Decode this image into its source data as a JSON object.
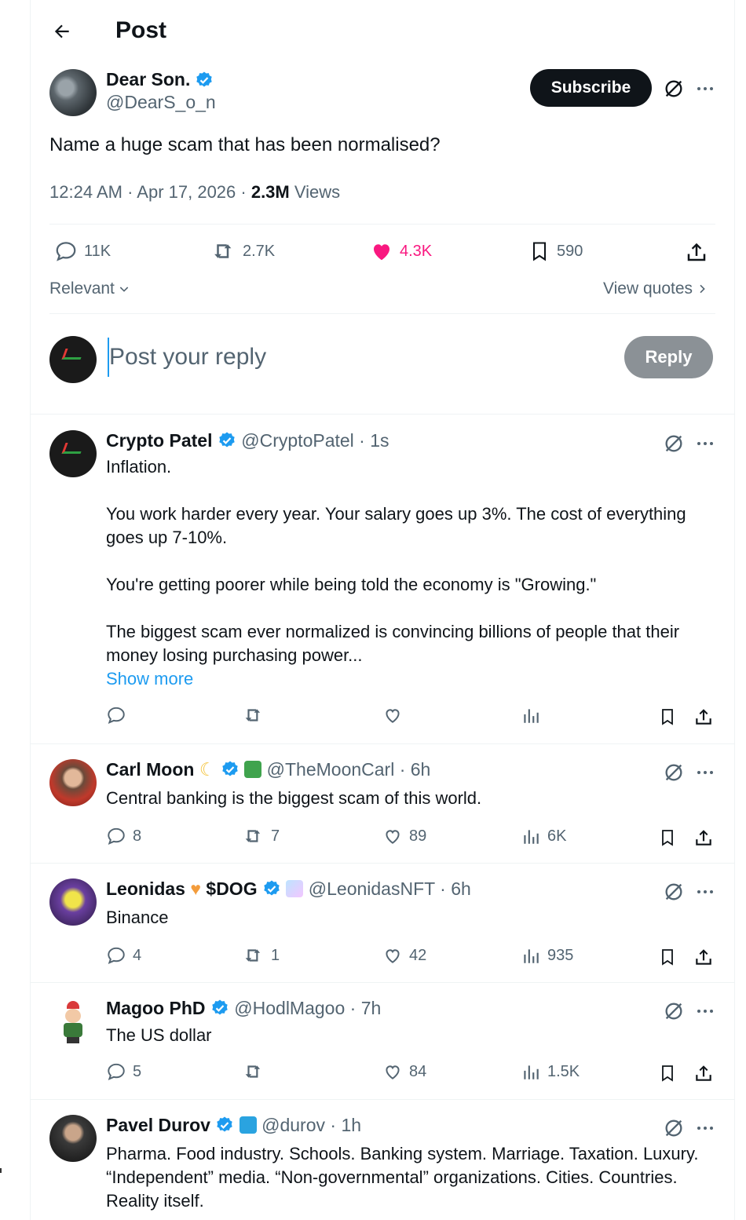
{
  "header": {
    "title": "Post"
  },
  "post": {
    "author_name": "Dear Son.",
    "author_handle": "@DearS_o_n",
    "subscribe_label": "Subscribe",
    "text": "Name a huge scam that has been normalised?",
    "time": "12:24 AM · Apr 17, 2026 · ",
    "views_count": "2.3M",
    "views_label": " Views",
    "stats": {
      "replies": "11K",
      "reposts": "2.7K",
      "likes": "4.3K",
      "bookmarks": "590"
    }
  },
  "filters": {
    "sort": "Relevant",
    "quotes": "View quotes"
  },
  "composer": {
    "placeholder": "Post your reply",
    "button": "Reply"
  },
  "replies": [
    {
      "name": "Crypto Patel",
      "handle": "@CryptoPatel · 1s",
      "body": [
        "Inflation.",
        "You work harder every year. Your salary goes up 3%. The cost of everything goes up 7-10%.",
        "You're getting poorer while being told the economy is \"Growing.\"",
        "The biggest scam ever normalized is convincing billions of people that their money losing purchasing power..."
      ],
      "show_more": "Show more"
    },
    {
      "name": "Carl Moon",
      "handle": "@TheMoonCarl · 6h",
      "body": "Central banking is the biggest scam of this world.",
      "stats": {
        "replies": "8",
        "reposts": "7",
        "likes": "89",
        "views": "6K"
      }
    },
    {
      "name": "Leonidas",
      "name_suffix": "$DOG",
      "handle": "@LeonidasNFT · 6h",
      "body": "Binance",
      "stats": {
        "replies": "4",
        "reposts": "1",
        "likes": "42",
        "views": "935"
      }
    },
    {
      "name": "Magoo PhD",
      "handle": "@HodlMagoo · 7h",
      "body": "The US dollar",
      "stats": {
        "replies": "5",
        "reposts": "",
        "likes": "84",
        "views": "1.5K"
      }
    },
    {
      "name": "Pavel Durov",
      "handle": "@durov · 1h",
      "body": "Pharma. Food industry. Schools. Banking system. Marriage. Taxation. Luxury. “Independent” media. “Non-governmental” organizations. Cities. Countries. Reality itself."
    }
  ],
  "colors": {
    "verified": "#1d9bf0",
    "like": "#f91880",
    "muted": "#536471",
    "divider": "#eff3f4"
  },
  "icons": [
    "back-arrow-icon",
    "verified-icon",
    "grok-icon",
    "more-icon",
    "reply-icon",
    "repost-icon",
    "like-icon",
    "bookmark-icon",
    "share-icon",
    "views-icon",
    "chevron-down-icon",
    "chevron-right-icon"
  ]
}
